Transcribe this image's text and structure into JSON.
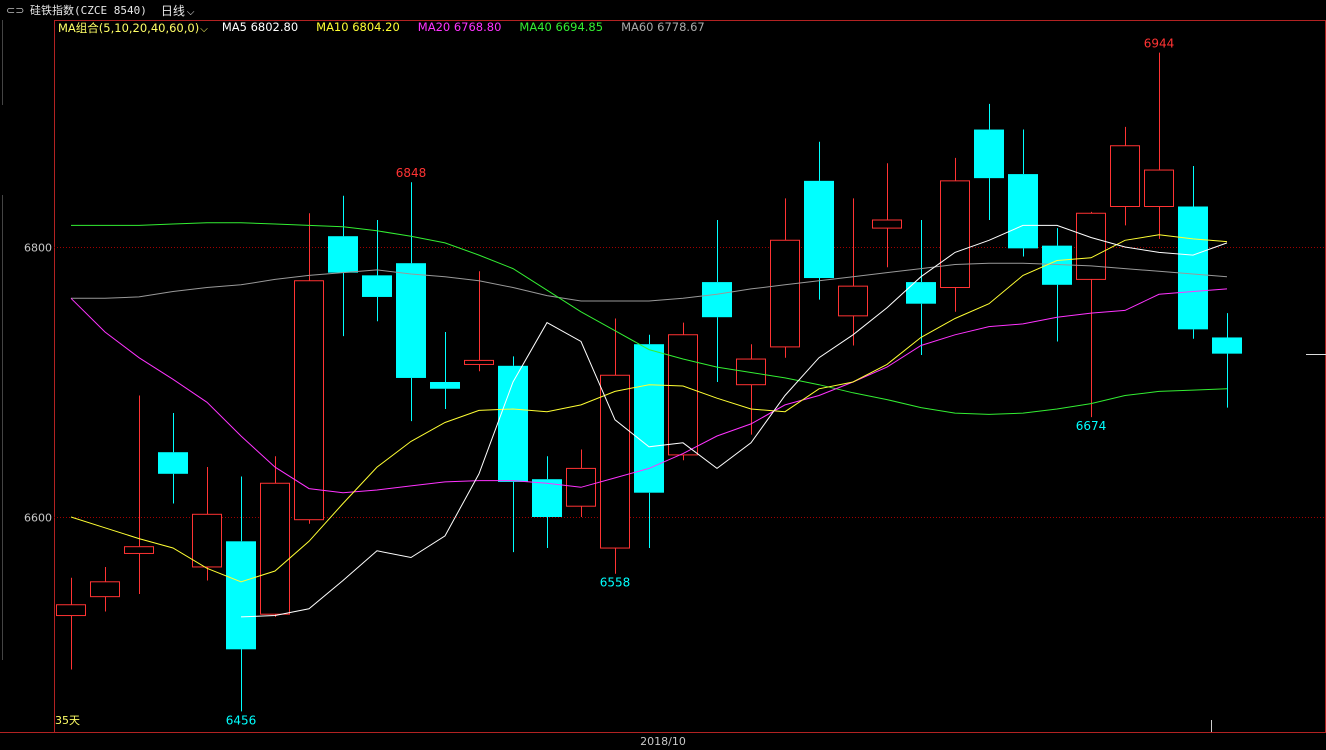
{
  "header": {
    "icon": "link-icon",
    "title": "硅铁指数(CZCE 8540)",
    "period": "日线",
    "period_icon": "chevron-down-icon"
  },
  "ma_legend": {
    "group": "MA组合(5,10,20,40,60,0)",
    "ma5": "MA5 6802.80",
    "ma10": "MA10 6804.20",
    "ma20": "MA20 6768.80",
    "ma40": "MA40 6694.85",
    "ma60": "MA60 6778.67"
  },
  "footer": {
    "date_label": "2018/10",
    "days_label": "35天"
  },
  "colors": {
    "up": "#ff3333",
    "down": "#00ffff",
    "ma5": "#ffffff",
    "ma10": "#ffff33",
    "ma20": "#ff33ff",
    "ma40": "#33ee33",
    "ma60": "#999999",
    "frame": "#b22222",
    "grid": "#a00000"
  },
  "chart_data": {
    "type": "candlestick",
    "ylim": [
      6456,
      6944
    ],
    "y_ticks": [
      6600,
      6800
    ],
    "candles": [
      {
        "o": 6527,
        "h": 6555,
        "l": 6487,
        "c": 6535
      },
      {
        "o": 6541,
        "h": 6563,
        "l": 6530,
        "c": 6552
      },
      {
        "o": 6573,
        "h": 6690,
        "l": 6543,
        "c": 6578
      },
      {
        "o": 6648,
        "h": 6677,
        "l": 6610,
        "c": 6632
      },
      {
        "o": 6563,
        "h": 6637,
        "l": 6553,
        "c": 6602
      },
      {
        "o": 6582,
        "h": 6630,
        "l": 6456,
        "c": 6502
      },
      {
        "o": 6528,
        "h": 6645,
        "l": 6526,
        "c": 6625
      },
      {
        "o": 6598,
        "h": 6825,
        "l": 6595,
        "c": 6775
      },
      {
        "o": 6808,
        "h": 6838,
        "l": 6734,
        "c": 6781
      },
      {
        "o": 6779,
        "h": 6820,
        "l": 6745,
        "c": 6763
      },
      {
        "o": 6788,
        "h": 6848,
        "l": 6671,
        "c": 6703
      },
      {
        "o": 6700,
        "h": 6737,
        "l": 6680,
        "c": 6695
      },
      {
        "o": 6713,
        "h": 6782,
        "l": 6708,
        "c": 6716
      },
      {
        "o": 6712,
        "h": 6719,
        "l": 6574,
        "c": 6626
      },
      {
        "o": 6628,
        "h": 6645,
        "l": 6577,
        "c": 6600
      },
      {
        "o": 6608,
        "h": 6650,
        "l": 6600,
        "c": 6636
      },
      {
        "o": 6577,
        "h": 6747,
        "l": 6558,
        "c": 6705
      },
      {
        "o": 6728,
        "h": 6735,
        "l": 6577,
        "c": 6618
      },
      {
        "o": 6646,
        "h": 6744,
        "l": 6642,
        "c": 6735
      },
      {
        "o": 6774,
        "h": 6820,
        "l": 6700,
        "c": 6748
      },
      {
        "o": 6698,
        "h": 6728,
        "l": 6661,
        "c": 6717
      },
      {
        "o": 6726,
        "h": 6836,
        "l": 6718,
        "c": 6805
      },
      {
        "o": 6849,
        "h": 6878,
        "l": 6761,
        "c": 6777
      },
      {
        "o": 6749,
        "h": 6836,
        "l": 6727,
        "c": 6771
      },
      {
        "o": 6814,
        "h": 6862,
        "l": 6785,
        "c": 6820
      },
      {
        "o": 6774,
        "h": 6820,
        "l": 6720,
        "c": 6758
      },
      {
        "o": 6770,
        "h": 6866,
        "l": 6752,
        "c": 6849
      },
      {
        "o": 6887,
        "h": 6906,
        "l": 6820,
        "c": 6851
      },
      {
        "o": 6854,
        "h": 6887,
        "l": 6793,
        "c": 6799
      },
      {
        "o": 6801,
        "h": 6814,
        "l": 6730,
        "c": 6772
      },
      {
        "o": 6776,
        "h": 6826,
        "l": 6674,
        "c": 6825
      },
      {
        "o": 6830,
        "h": 6889,
        "l": 6816,
        "c": 6875
      },
      {
        "o": 6830,
        "h": 6944,
        "l": 6806,
        "c": 6857
      },
      {
        "o": 6830,
        "h": 6860,
        "l": 6732,
        "c": 6739
      },
      {
        "o": 6733,
        "h": 6751,
        "l": 6681,
        "c": 6721
      }
    ],
    "ma5": [
      6526,
      6527,
      6532,
      6553,
      6575,
      6570,
      6586,
      6632,
      6700,
      6744,
      6730,
      6672,
      6652,
      6655,
      6636,
      6655,
      6690,
      6718,
      6735,
      6755,
      6778,
      6796,
      6805,
      6816,
      6816,
      6807,
      6800,
      6796,
      6794,
      6803
    ],
    "ma10": [
      6600,
      6592,
      6584,
      6577,
      6562,
      6552,
      6560,
      6582,
      6610,
      6637,
      6656,
      6670,
      6679,
      6680,
      6678,
      6683,
      6693,
      6698,
      6697,
      6688,
      6680,
      6678,
      6695,
      6700,
      6713,
      6733,
      6747,
      6758,
      6779,
      6790,
      6792,
      6805,
      6809,
      6806,
      6804
    ],
    "ma20": [
      6762,
      6737,
      6718,
      6702,
      6685,
      6660,
      6637,
      6621,
      6618,
      6620,
      6623,
      6626,
      6627,
      6627,
      6625,
      6622,
      6629,
      6636,
      6647,
      6660,
      6669,
      6683,
      6690,
      6700,
      6711,
      6727,
      6735,
      6741,
      6743,
      6748,
      6751,
      6753,
      6765,
      6767,
      6769
    ],
    "ma40": [
      6816,
      6816,
      6816,
      6817,
      6818,
      6818,
      6817,
      6816,
      6815,
      6812,
      6808,
      6803,
      6794,
      6784,
      6768,
      6752,
      6738,
      6724,
      6717,
      6711,
      6707,
      6703,
      6698,
      6692,
      6687,
      6681,
      6677,
      6676,
      6677,
      6680,
      6684,
      6690,
      6693,
      6694,
      6695
    ],
    "ma60": [
      6762,
      6762,
      6763,
      6767,
      6770,
      6772,
      6776,
      6779,
      6781,
      6783,
      6780,
      6778,
      6775,
      6770,
      6764,
      6760,
      6760,
      6760,
      6762,
      6765,
      6769,
      6772,
      6775,
      6778,
      6781,
      6784,
      6787,
      6788,
      6788,
      6787,
      6786,
      6784,
      6782,
      6780,
      6778
    ],
    "ma5_start_index": 5,
    "annotations": [
      {
        "index": 5,
        "value": "6456",
        "pos": "low",
        "color": "down"
      },
      {
        "index": 10,
        "value": "6848",
        "pos": "high",
        "color": "up"
      },
      {
        "index": 16,
        "value": "6558",
        "pos": "low",
        "color": "down"
      },
      {
        "index": 30,
        "value": "6674",
        "pos": "low",
        "color": "down"
      },
      {
        "index": 32,
        "value": "6944",
        "pos": "high",
        "color": "up"
      }
    ],
    "last_price": 6721
  }
}
